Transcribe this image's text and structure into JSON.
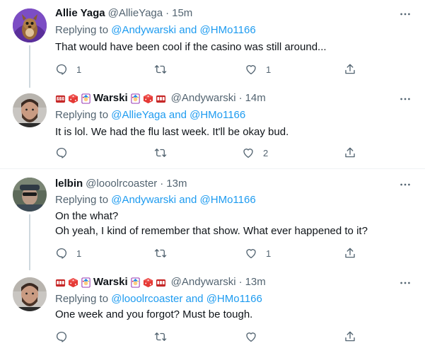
{
  "tweets": [
    {
      "name": "Allie Yaga",
      "handle": "@AllieYaga",
      "dot": "·",
      "time": "15m",
      "replying_prefix": "Replying to ",
      "mention1": "@Andywarski",
      "and": " and ",
      "mention2": "@HMo1166",
      "text": [
        "That would have been cool if the casino was still around..."
      ],
      "replies": "1",
      "retweets": "",
      "likes": "1"
    },
    {
      "name": "Warski",
      "handle": "@Andywarski",
      "dot": "·",
      "time": "14m",
      "replying_prefix": "Replying to ",
      "mention1": "@AllieYaga",
      "and": " and ",
      "mention2": "@HMo1166",
      "text": [
        "It is lol. We had the flu last week. It'll be okay bud."
      ],
      "replies": "",
      "retweets": "",
      "likes": "2"
    },
    {
      "name": "lelbin",
      "handle": "@looolrcoaster",
      "dot": "·",
      "time": "13m",
      "replying_prefix": "Replying to ",
      "mention1": "@Andywarski",
      "and": " and ",
      "mention2": "@HMo1166",
      "text": [
        "On the what?",
        "Oh yeah, I kind of remember that show. What ever happened to it?"
      ],
      "replies": "1",
      "retweets": "",
      "likes": "1"
    },
    {
      "name": "Warski",
      "handle": "@Andywarski",
      "dot": "·",
      "time": "13m",
      "replying_prefix": "Replying to ",
      "mention1": "@looolrcoaster",
      "and": " and ",
      "mention2": "@HMo1166",
      "text": [
        "One week and you forgot? Must be tough."
      ],
      "replies": "",
      "retweets": "",
      "likes": ""
    }
  ],
  "colors": {
    "link": "#1d9bf0",
    "secondary": "#536471",
    "primary": "#0f1419",
    "divider": "#eff3f4"
  },
  "icons": [
    "reply-icon",
    "retweet-icon",
    "like-icon",
    "share-icon",
    "more-icon"
  ]
}
